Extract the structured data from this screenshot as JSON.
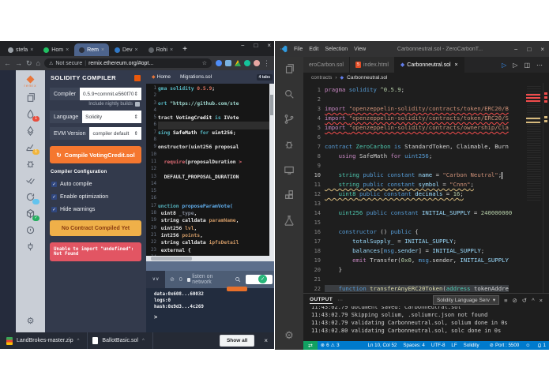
{
  "chrome": {
    "tabs": [
      {
        "label": "stefa",
        "fav": "#9aa0a6",
        "close": "×",
        "active": false
      },
      {
        "label": "Hom",
        "fav": "#21c063",
        "close": "×",
        "active": false
      },
      {
        "label": "Rem",
        "fav": "#2b2f3a",
        "close": "×",
        "active": true
      },
      {
        "label": "Dev",
        "fav": "#3178c6",
        "close": "×",
        "active": false
      },
      {
        "label": "Rohi",
        "fav": "#5f6368",
        "close": "×",
        "active": false
      }
    ],
    "new_tab": "+",
    "window_controls": {
      "minimize": "−",
      "maximize": "□",
      "close": "×"
    },
    "nav": {
      "back": "←",
      "forward": "→",
      "reload": "↻",
      "home": "⌂"
    },
    "address": {
      "warning_icon": "⚠",
      "warning": "Not secure",
      "divider": "|",
      "url": "remix.ethereum.org/#opt...",
      "star": "☆"
    },
    "extensions": [
      "blue-extension-icon",
      "windows-extension-icon",
      "drive-icon",
      "grammarly-icon",
      "avatar",
      "menu-dots"
    ],
    "menu_dots": "⋮",
    "downloads": {
      "items": [
        {
          "name": "LandBrokes-master.zip",
          "caret": "^",
          "icon": "zip"
        },
        {
          "name": "BallotBasic.sol",
          "caret": "^",
          "icon": "file"
        }
      ],
      "show_all": "Show all",
      "close": "×"
    }
  },
  "remix": {
    "logo_glyph": "◆",
    "logo_text": "remix",
    "sidebar": [
      {
        "name": "file-explorer-icon",
        "icon": "files"
      },
      {
        "name": "solidity-compiler-icon",
        "icon": "droplet",
        "badge": {
          "text": "1",
          "color": "#e74c3c"
        }
      },
      {
        "name": "deploy-run-icon",
        "icon": "deploy"
      },
      {
        "name": "analysis-icon",
        "icon": "chart",
        "badge": {
          "text": "1",
          "color": "#f1b53d"
        }
      },
      {
        "name": "debugger-icon",
        "icon": "bug"
      },
      {
        "name": "unit-testing-icon",
        "icon": "checks"
      },
      {
        "name": "static-analysis-icon",
        "icon": "refresh",
        "badge": {
          "text": "",
          "color": "#62c3ee"
        }
      },
      {
        "name": "plugin-box-icon",
        "icon": "box",
        "badge": {
          "text": "✓",
          "color": "#27ae60"
        }
      },
      {
        "name": "support-icon",
        "icon": "circle"
      },
      {
        "name": "plugin-manager-icon",
        "icon": "plug"
      }
    ],
    "settings_glyph": "⚙",
    "panel": {
      "header": "SOLIDITY COMPILER",
      "compiler_label": "Compiler",
      "compiler_value": "0.5.9+commit.e560f70",
      "select_arrows": "⇕",
      "nightly": "Include nightly builds",
      "language_label": "Language",
      "language_value": "Solidity",
      "evm_label": "EVM Version",
      "evm_value": "compiler default",
      "compile_icon": "↻",
      "compile_button": "Compile VotingCredit.sol",
      "config_header": "Compiler Configuration",
      "checkboxes": [
        "Auto compile",
        "Enable optimization",
        "Hide warnings"
      ],
      "check_glyph": "✓",
      "warning_button": "No Contract Compiled Yet",
      "error_message": "Unable to import \"undefined\": Not Found"
    },
    "editor": {
      "tabs": [
        {
          "label": "Home",
          "icon": true
        },
        {
          "label": "Migrations.sol",
          "icon": false
        }
      ],
      "badge": "4 tabs",
      "lines": [
        {
          "n": 1,
          "t": [
            [
              "k",
              "gma solidity "
            ],
            [
              "num",
              "0.5.9"
            ],
            [
              "w",
              ";"
            ]
          ]
        },
        {
          "n": 2,
          "t": []
        },
        {
          "n": 3,
          "t": [
            [
              "k",
              "ort "
            ],
            [
              "str",
              "\"https://github.com/ste"
            ]
          ]
        },
        {
          "n": 4,
          "t": []
        },
        {
          "n": 5,
          "t": [
            [
              "w",
              "tract "
            ],
            [
              "wb",
              "VotingCredit "
            ],
            [
              "k",
              "is "
            ],
            [
              "w",
              "IVote"
            ]
          ]
        },
        {
          "n": 6,
          "t": [],
          "hl": true
        },
        {
          "n": 7,
          "t": [
            [
              "k",
              "sing "
            ],
            [
              "wb",
              "SafeMath "
            ],
            [
              "k",
              "for "
            ],
            [
              "wb",
              "uint256"
            ],
            [
              "w",
              ";"
            ]
          ]
        },
        {
          "n": 8,
          "t": []
        },
        {
          "n": 9,
          "t": [
            [
              "w",
              "onstructor(uint256 proposal"
            ]
          ]
        },
        {
          "n": 10,
          "t": []
        },
        {
          "n": 11,
          "t": [
            [
              "w",
              "  "
            ],
            [
              "req",
              "require"
            ],
            [
              "w",
              "(proposalDuration "
            ],
            [
              "req",
              ">"
            ]
          ]
        },
        {
          "n": 12,
          "t": []
        },
        {
          "n": 13,
          "t": [
            [
              "w",
              "  DEFAULT_PROPOSAL_DURATION"
            ]
          ]
        },
        {
          "n": 14,
          "t": []
        },
        {
          "n": 15,
          "t": []
        },
        {
          "n": 16,
          "t": []
        },
        {
          "n": 17,
          "t": [
            [
              "k",
              "unction "
            ],
            [
              "fn",
              "proposeParamVote("
            ]
          ]
        },
        {
          "n": 18,
          "t": [
            [
              "w",
              " uint8 "
            ],
            [
              "mut",
              "_type"
            ],
            [
              "w",
              ","
            ]
          ]
        },
        {
          "n": 19,
          "t": [
            [
              "w",
              " string calldata "
            ],
            [
              "param",
              "paramName"
            ],
            [
              "w",
              ","
            ]
          ]
        },
        {
          "n": 20,
          "t": [
            [
              "w",
              " uint256 "
            ],
            [
              "param",
              "lvl"
            ],
            [
              "w",
              ","
            ]
          ]
        },
        {
          "n": 21,
          "t": [
            [
              "w",
              " int256 "
            ],
            [
              "param",
              "points"
            ],
            [
              "w",
              ","
            ]
          ]
        },
        {
          "n": 22,
          "t": [
            [
              "w",
              " string calldata "
            ],
            [
              "param",
              "ipfsDetail"
            ]
          ]
        },
        {
          "n": 23,
          "t": [
            [
              "w",
              " external {"
            ]
          ]
        },
        {
          "n": 24,
          "t": []
        },
        {
          "n": 25,
          "t": []
        }
      ]
    },
    "terminal": {
      "expand_glyphs": "∨∨",
      "zero_icon": "⊘",
      "zero": "0",
      "listen": "listen on network",
      "lines": [
        "data:0x608...60032",
        "logs:0",
        "hash:0x9d3...4c269"
      ],
      "prompt": ">"
    }
  },
  "vscode": {
    "menus": [
      "File",
      "Edit",
      "Selection",
      "View"
    ],
    "title": "Carbonneutral.sol - ZeroCarbonT...",
    "window_controls": {
      "minimize": "−",
      "maximize": "□",
      "close": "×"
    },
    "activity": [
      {
        "name": "explorer-icon",
        "icon": "files"
      },
      {
        "name": "search-icon",
        "icon": "search"
      },
      {
        "name": "source-control-icon",
        "icon": "branch"
      },
      {
        "name": "debug-icon",
        "icon": "bug"
      },
      {
        "name": "remote-icon",
        "icon": "screen"
      },
      {
        "name": "extensions-icon",
        "icon": "ext"
      },
      {
        "name": "test-beaker-icon",
        "icon": "beaker"
      }
    ],
    "settings_glyph": "⚙",
    "tabs": [
      {
        "label": "eroCarbon.sol",
        "icon": "none",
        "active": false
      },
      {
        "label": "index.html",
        "icon": "html",
        "active": false
      },
      {
        "label": "Carbonneutral.sol",
        "icon": "eth",
        "active": true,
        "close": "×"
      }
    ],
    "tab_actions": {
      "debug": "▷",
      "run": "▷",
      "split": "◫",
      "more": "⋯"
    },
    "breadcrumb": {
      "root": "contracts",
      "sep": "›",
      "file_icon": "◆",
      "file": "Carbonneutral.sol"
    },
    "editor": {
      "lines": [
        {
          "n": 1,
          "t": [
            [
              "m",
              "pragma "
            ],
            [
              "b",
              "solidity "
            ],
            [
              "n",
              "^0.5.9"
            ],
            [
              "w",
              ";"
            ]
          ]
        },
        {
          "n": 2,
          "t": []
        },
        {
          "n": 3,
          "t": [
            [
              "m",
              "import "
            ],
            [
              "s",
              "\"openzeppelin-solidity/contracts/token/ERC20/B"
            ]
          ],
          "sq": "red"
        },
        {
          "n": 4,
          "t": [
            [
              "m",
              "import "
            ],
            [
              "s",
              "\"openzeppelin-solidity/contracts/token/ERC20/S"
            ]
          ],
          "sq": "red"
        },
        {
          "n": 5,
          "t": [
            [
              "m",
              "import "
            ],
            [
              "s",
              "\"openzeppelin-solidity/contracts/ownership/Cla"
            ]
          ],
          "sq": "red"
        },
        {
          "n": 6,
          "t": []
        },
        {
          "n": 7,
          "t": [
            [
              "b",
              "contract "
            ],
            [
              "t",
              "ZeroCarbon "
            ],
            [
              "b",
              "is "
            ],
            [
              "w",
              "StandardToken, Claimable, Burn"
            ]
          ]
        },
        {
          "n": 8,
          "t": [
            [
              "m",
              "    using "
            ],
            [
              "w",
              "SafeMath "
            ],
            [
              "m",
              "for "
            ],
            [
              "b",
              "uint256"
            ],
            [
              "w",
              ";"
            ]
          ]
        },
        {
          "n": 9,
          "t": []
        },
        {
          "n": 10,
          "t": [
            [
              "t",
              "    string "
            ],
            [
              "b",
              "public constant "
            ],
            [
              "v",
              "name"
            ],
            [
              "w",
              " = "
            ],
            [
              "s",
              "\"Carbon Neutral\""
            ],
            [
              "w",
              ";"
            ]
          ],
          "active": true,
          "cursor": true
        },
        {
          "n": 11,
          "t": [
            [
              "t",
              "    string "
            ],
            [
              "b",
              "public constant "
            ],
            [
              "v",
              "symbol"
            ],
            [
              "w",
              " = "
            ],
            [
              "s",
              "\"Cnnn\""
            ],
            [
              "w",
              ";"
            ]
          ],
          "sq": "yellow"
        },
        {
          "n": 12,
          "t": [
            [
              "t",
              "    uint8 "
            ],
            [
              "b",
              "public constant "
            ],
            [
              "v",
              "decimals"
            ],
            [
              "w",
              " = "
            ],
            [
              "n",
              "16"
            ],
            [
              "w",
              ";"
            ]
          ],
          "sq": "yellow"
        },
        {
          "n": 13,
          "t": []
        },
        {
          "n": 14,
          "t": [
            [
              "t",
              "    uint256 "
            ],
            [
              "b",
              "public constant "
            ],
            [
              "v",
              "INITIAL_SUPPLY"
            ],
            [
              "w",
              " = "
            ],
            [
              "n",
              "240000000"
            ]
          ]
        },
        {
          "n": 15,
          "t": []
        },
        {
          "n": 16,
          "t": [
            [
              "b",
              "    constructor "
            ],
            [
              "w",
              "() "
            ],
            [
              "b",
              "public "
            ],
            [
              "w",
              "{"
            ]
          ]
        },
        {
          "n": 17,
          "t": [
            [
              "v",
              "        totalSupply_ "
            ],
            [
              "w",
              "= "
            ],
            [
              "v",
              "INITIAL_SUPPLY"
            ],
            [
              "w",
              ";"
            ]
          ]
        },
        {
          "n": 18,
          "t": [
            [
              "v",
              "        balances"
            ],
            [
              "w",
              "["
            ],
            [
              "b",
              "msg"
            ],
            [
              "w",
              "."
            ],
            [
              "v",
              "sender"
            ],
            [
              "w",
              "] = "
            ],
            [
              "v",
              "INITIAL_SUPPLY"
            ],
            [
              "w",
              ";"
            ]
          ]
        },
        {
          "n": 19,
          "t": [
            [
              "m",
              "        emit "
            ],
            [
              "w",
              "Transfer("
            ],
            [
              "n",
              "0x0"
            ],
            [
              "w",
              ", "
            ],
            [
              "b",
              "msg"
            ],
            [
              "w",
              ".sender, "
            ],
            [
              "v",
              "INITIAL_SUPPLY"
            ]
          ]
        },
        {
          "n": 20,
          "t": [
            [
              "w",
              "    }"
            ]
          ]
        },
        {
          "n": 21,
          "t": []
        },
        {
          "n": 22,
          "t": [
            [
              "b",
              "    function "
            ],
            [
              "f",
              "transferAnyERC20Token"
            ],
            [
              "w",
              "("
            ],
            [
              "t",
              "address "
            ],
            [
              "w",
              "tokenAddre"
            ]
          ],
          "hl": true
        }
      ]
    },
    "output": {
      "tab": "OUTPUT",
      "more": "···",
      "dropdown": "Solidity Language Serv",
      "dropdown_arrow": "▾",
      "icons": {
        "wrap": "≡",
        "lock": "⊘",
        "clear": "↺",
        "collapse": "^",
        "close": "×"
      },
      "lines": [
        "11:43:02.79 document saved: Carbonneutral.sol",
        "11:43:02.79 Skipping solium, .soliumrc.json not found",
        "11:43:02.79 validating Carbonneutral.sol, solium done in 0s",
        "11:43:02.80 validating Carbonneutral.sol, solc done in 0s"
      ]
    },
    "status": {
      "live_glyph": "⇄",
      "error_icon": "⊗",
      "errors": "6",
      "warning_icon": "⚠",
      "warnings": "3",
      "position": "Ln 10, Col 52",
      "spaces": "Spaces: 4",
      "encoding": "UTF-8",
      "eol": "LF",
      "language": "Solidity",
      "port_icon": "⊘",
      "port": "Port : 5500",
      "feedback": "☺",
      "bell_count": "1"
    }
  },
  "colors": {
    "chrome_tab_active": "#4d648d",
    "remix_accent_orange": "#f5772f",
    "remix_warning_yellow": "#efb049",
    "remix_error_red": "#e25563",
    "vscode_status_blue": "#007acc",
    "vscode_live_green": "#12a162"
  }
}
